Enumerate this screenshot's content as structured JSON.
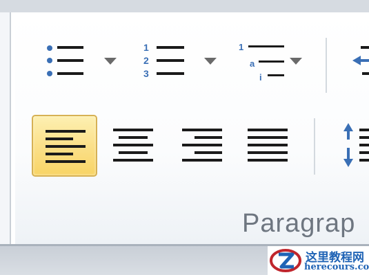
{
  "ribbon": {
    "group_label": "Paragrap",
    "row1": [
      {
        "name": "bullets-button",
        "icon": "bullet-list-icon",
        "has_dropdown": true
      },
      {
        "name": "numbering-button",
        "icon": "numbered-list-icon",
        "has_dropdown": true,
        "numbers": [
          "1",
          "2",
          "3"
        ]
      },
      {
        "name": "multilevel-list-button",
        "icon": "multilevel-list-icon",
        "has_dropdown": true,
        "numbers": [
          "1",
          "a",
          "i"
        ]
      },
      {
        "name": "decrease-indent-button",
        "icon": "decrease-indent-icon",
        "has_dropdown": false
      }
    ],
    "row2": [
      {
        "name": "align-left-button",
        "icon": "align-left-icon",
        "active": true
      },
      {
        "name": "center-button",
        "icon": "align-center-icon",
        "active": false
      },
      {
        "name": "align-right-button",
        "icon": "align-right-icon",
        "active": false
      },
      {
        "name": "justify-button",
        "icon": "justify-icon",
        "active": false
      },
      {
        "name": "line-spacing-button",
        "icon": "line-spacing-icon",
        "active": false
      }
    ]
  },
  "colors": {
    "active_fill": "#fbe08a",
    "active_border": "#d6b154",
    "icon_dark": "#1a1a1a",
    "icon_blue": "#3a6fb5",
    "label": "#6e7680"
  },
  "watermark": {
    "title": "这里教程网",
    "url": "herecours.com",
    "logo_icon": "z-logo-icon"
  }
}
